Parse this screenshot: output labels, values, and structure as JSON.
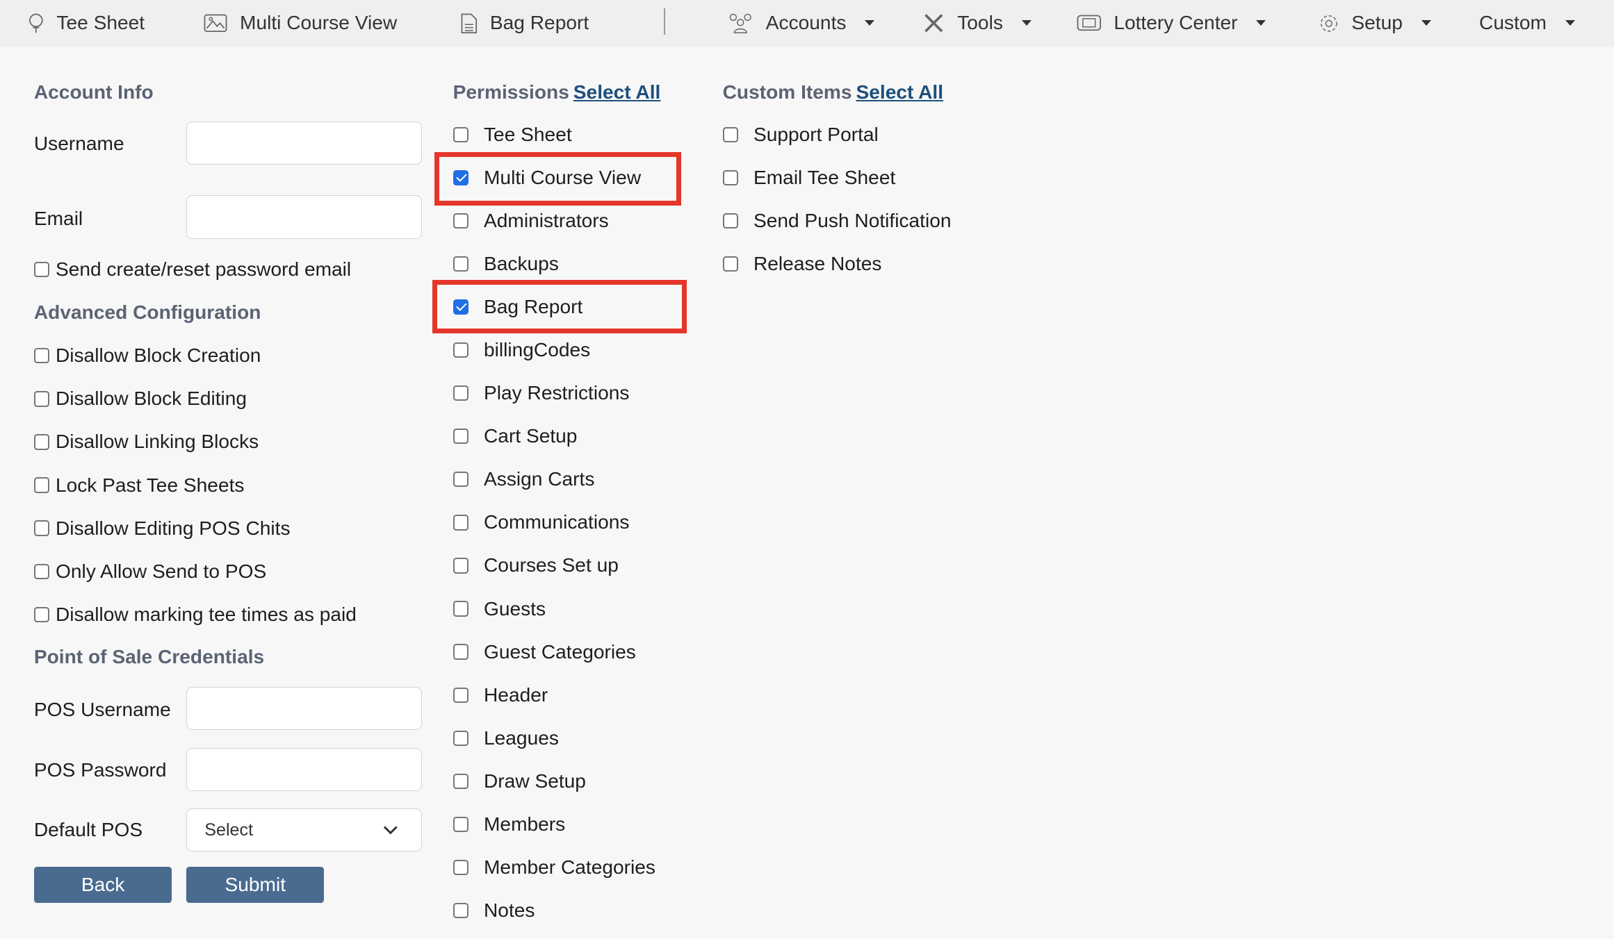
{
  "nav": {
    "items": [
      {
        "label": "Tee Sheet",
        "icon": "golf-tee-icon"
      },
      {
        "label": "Multi Course View",
        "icon": "image-icon"
      },
      {
        "label": "Bag Report",
        "icon": "document-icon"
      },
      {
        "label": "Accounts",
        "icon": "users-icon",
        "dropdown": true
      },
      {
        "label": "Tools",
        "icon": "tools-icon",
        "dropdown": true
      },
      {
        "label": "Lottery Center",
        "icon": "ticket-icon",
        "dropdown": true
      },
      {
        "label": "Setup",
        "icon": "gear-icon",
        "dropdown": true
      },
      {
        "label": "Custom",
        "dropdown": true
      }
    ]
  },
  "account": {
    "heading": "Account Info",
    "username_label": "Username",
    "username_value": "",
    "email_label": "Email",
    "email_value": "",
    "send_email_label": "Send create/reset password email",
    "send_email_checked": false
  },
  "advanced": {
    "heading": "Advanced Configuration",
    "items": [
      {
        "label": "Disallow Block Creation",
        "checked": false
      },
      {
        "label": "Disallow Block Editing",
        "checked": false
      },
      {
        "label": "Disallow Linking Blocks",
        "checked": false
      },
      {
        "label": "Lock Past Tee Sheets",
        "checked": false
      },
      {
        "label": "Disallow Editing POS Chits",
        "checked": false
      },
      {
        "label": "Only Allow Send to POS",
        "checked": false
      },
      {
        "label": "Disallow marking tee times as paid",
        "checked": false
      }
    ]
  },
  "pos": {
    "heading": "Point of Sale Credentials",
    "username_label": "POS Username",
    "password_label": "POS Password",
    "default_label": "Default POS",
    "default_value": "Select"
  },
  "buttons": {
    "back": "Back",
    "submit": "Submit"
  },
  "permissions": {
    "heading": "Permissions",
    "select_all": "Select All",
    "items": [
      {
        "label": "Tee Sheet",
        "checked": false
      },
      {
        "label": "Multi Course View",
        "checked": true,
        "highlighted": true
      },
      {
        "label": "Administrators",
        "checked": false
      },
      {
        "label": "Backups",
        "checked": false
      },
      {
        "label": "Bag Report",
        "checked": true,
        "highlighted": true
      },
      {
        "label": "billingCodes",
        "checked": false
      },
      {
        "label": "Play Restrictions",
        "checked": false
      },
      {
        "label": "Cart Setup",
        "checked": false
      },
      {
        "label": "Assign Carts",
        "checked": false
      },
      {
        "label": "Communications",
        "checked": false
      },
      {
        "label": "Courses Set up",
        "checked": false
      },
      {
        "label": "Guests",
        "checked": false
      },
      {
        "label": "Guest Categories",
        "checked": false
      },
      {
        "label": "Header",
        "checked": false
      },
      {
        "label": "Leagues",
        "checked": false
      },
      {
        "label": "Draw Setup",
        "checked": false
      },
      {
        "label": "Members",
        "checked": false
      },
      {
        "label": "Member Categories",
        "checked": false
      },
      {
        "label": "Notes",
        "checked": false
      }
    ]
  },
  "custom": {
    "heading": "Custom Items",
    "select_all": "Select All",
    "items": [
      {
        "label": "Support Portal",
        "checked": false
      },
      {
        "label": "Email Tee Sheet",
        "checked": false
      },
      {
        "label": "Send Push Notification",
        "checked": false
      },
      {
        "label": "Release Notes",
        "checked": false
      }
    ]
  },
  "colors": {
    "highlight": "#e5362a",
    "button": "#4a6b90",
    "link": "#1d4f7c",
    "checkbox_checked": "#1f6fe5"
  }
}
